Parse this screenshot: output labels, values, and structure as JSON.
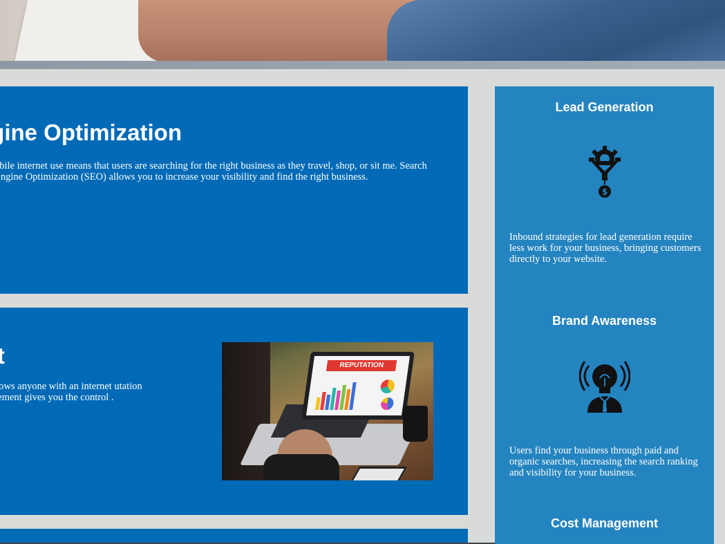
{
  "hero": {
    "icon": "hero-photo"
  },
  "main": {
    "cards": [
      {
        "title": "ngine Optimization",
        "text": "obile internet use means that users are searching for the right business as they travel, shop, or sit me. Search Engine Optimization (SEO) allows you to increase your visibility and find the right business."
      },
      {
        "title": "t",
        "text": "edia allows anyone with an internet utation Management gives you the control .",
        "image_label": "REPUTATION"
      }
    ]
  },
  "sidebar": {
    "items": [
      {
        "heading": "Lead Generation",
        "icon": "funnel-gear-dollar-icon",
        "text": "Inbound strategies for lead generation require less work for your business, bringing customers directly to your website."
      },
      {
        "heading": "Brand Awareness",
        "icon": "lightbulb-head-broadcast-icon",
        "text": "Users find your business through paid and organic searches, increasing the search ranking and visibility for your business."
      },
      {
        "heading": "Cost Management",
        "icon": "",
        "text": ""
      }
    ]
  },
  "colors": {
    "card_blue": "#006ab7",
    "sidebar_blue": "#2484c0",
    "page_gray": "#d9dbd8"
  }
}
